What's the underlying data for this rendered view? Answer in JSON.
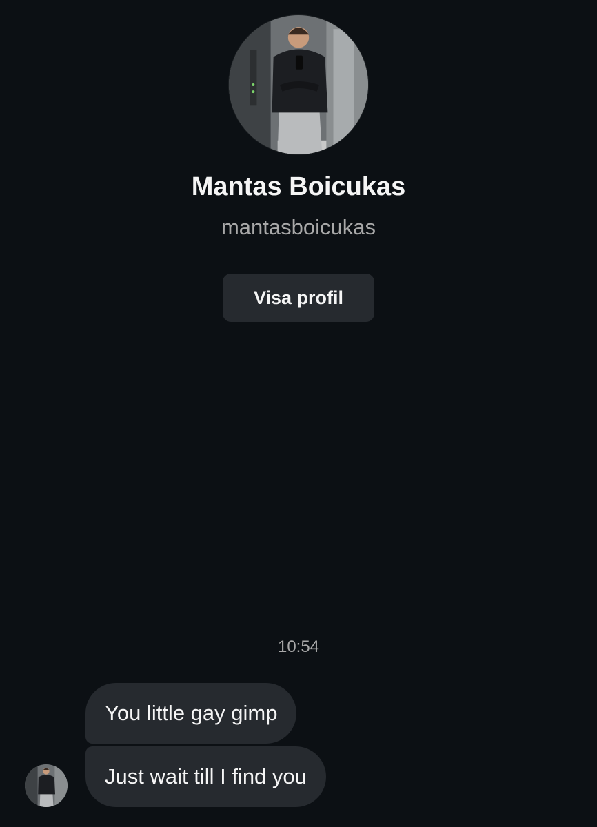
{
  "profile": {
    "display_name": "Mantas Boicukas",
    "username": "mantasboicukas",
    "view_profile_label": "Visa profil"
  },
  "conversation": {
    "timestamp": "10:54",
    "messages": [
      {
        "sender": "them",
        "text": "You little gay gimp"
      },
      {
        "sender": "them",
        "text": "Just wait till I find you"
      }
    ]
  },
  "colors": {
    "background": "#0c1014",
    "bubble": "#262a2f",
    "secondary_text": "#a8a8a8",
    "primary_text": "#f5f5f5"
  }
}
